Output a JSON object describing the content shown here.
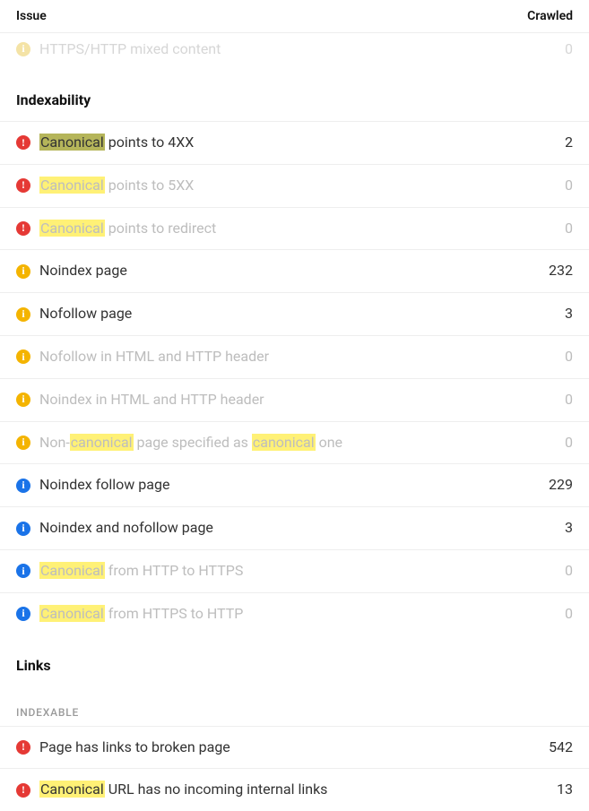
{
  "header": {
    "issue": "Issue",
    "crawled": "Crawled"
  },
  "top_faded": {
    "label": "HTTPS/HTTP mixed content",
    "count": "0",
    "severity": "warn"
  },
  "groups": [
    {
      "title": "Indexability",
      "rows": [
        {
          "severity": "error",
          "muted": false,
          "count": "2",
          "parts": [
            "",
            "Canonical",
            " points to 4XX"
          ],
          "hlClass": "sel"
        },
        {
          "severity": "error",
          "muted": true,
          "count": "0",
          "parts": [
            "",
            "Canonical",
            " points to 5XX"
          ]
        },
        {
          "severity": "error",
          "muted": true,
          "count": "0",
          "parts": [
            "",
            "Canonical",
            " points to redirect"
          ]
        },
        {
          "severity": "warn",
          "muted": false,
          "count": "232",
          "parts": [
            "Noindex page"
          ]
        },
        {
          "severity": "warn",
          "muted": false,
          "count": "3",
          "parts": [
            "Nofollow page"
          ]
        },
        {
          "severity": "warn",
          "muted": true,
          "count": "0",
          "parts": [
            "Nofollow in HTML and HTTP header"
          ]
        },
        {
          "severity": "warn",
          "muted": true,
          "count": "0",
          "parts": [
            "Noindex in HTML and HTTP header"
          ]
        },
        {
          "severity": "warn",
          "muted": true,
          "count": "0",
          "parts": [
            "Non-",
            "canonical",
            " page specified as ",
            "canonical",
            " one"
          ]
        },
        {
          "severity": "info",
          "muted": false,
          "count": "229",
          "parts": [
            "Noindex follow page"
          ]
        },
        {
          "severity": "info",
          "muted": false,
          "count": "3",
          "parts": [
            "Noindex and nofollow page"
          ]
        },
        {
          "severity": "info",
          "muted": true,
          "count": "0",
          "parts": [
            "",
            "Canonical",
            " from HTTP to HTTPS"
          ]
        },
        {
          "severity": "info",
          "muted": true,
          "count": "0",
          "parts": [
            "",
            "Canonical",
            " from HTTPS to HTTP"
          ]
        }
      ]
    },
    {
      "title": "Links",
      "subsections": [
        {
          "label": "INDEXABLE",
          "rows": [
            {
              "severity": "error",
              "muted": false,
              "count": "542",
              "parts": [
                "Page has links to broken page"
              ]
            },
            {
              "severity": "error",
              "muted": false,
              "count": "13",
              "parts": [
                "",
                "Canonical",
                " URL has no incoming internal links"
              ]
            }
          ]
        }
      ]
    }
  ],
  "glyph": {
    "error": "!",
    "warn": "i",
    "info": "i"
  }
}
